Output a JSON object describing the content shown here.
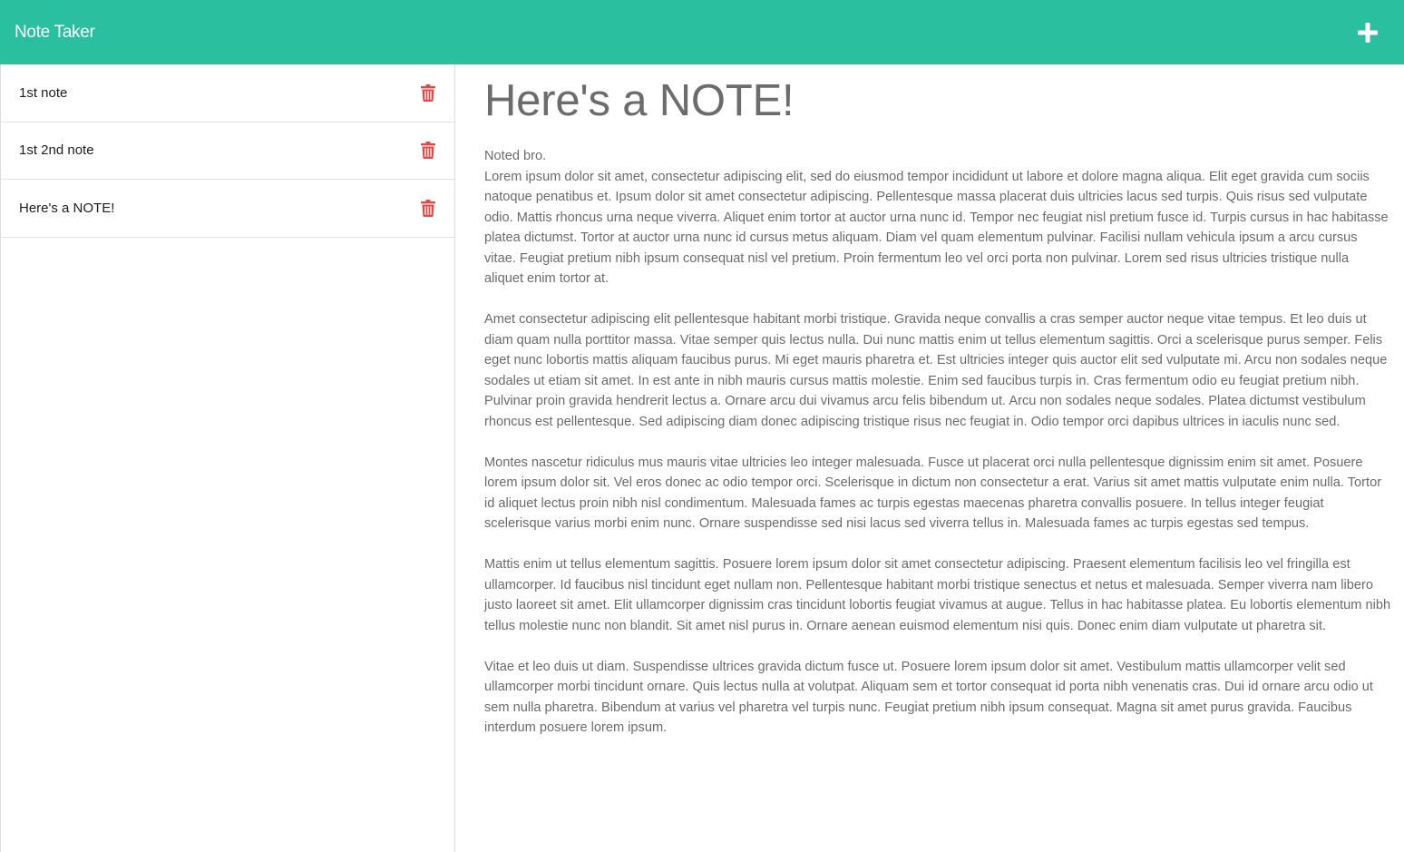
{
  "app": {
    "title": "Note Taker",
    "accent_color": "#2abf9e",
    "delete_color": "#dc4a4a"
  },
  "toolbar": {
    "add_icon": "plus-icon"
  },
  "sidebar": {
    "notes": [
      {
        "title": "1st note"
      },
      {
        "title": "1st 2nd note"
      },
      {
        "title": "Here's a NOTE!"
      }
    ],
    "delete_icon": "trash-icon"
  },
  "active_note": {
    "title": "Here's a NOTE!",
    "text": "Noted bro.\nLorem ipsum dolor sit amet, consectetur adipiscing elit, sed do eiusmod tempor incididunt ut labore et dolore magna aliqua. Elit eget gravida cum sociis natoque penatibus et. Ipsum dolor sit amet consectetur adipiscing. Pellentesque massa placerat duis ultricies lacus sed turpis. Quis risus sed vulputate odio. Mattis rhoncus urna neque viverra. Aliquet enim tortor at auctor urna nunc id. Tempor nec feugiat nisl pretium fusce id. Turpis cursus in hac habitasse platea dictumst. Tortor at auctor urna nunc id cursus metus aliquam. Diam vel quam elementum pulvinar. Facilisi nullam vehicula ipsum a arcu cursus vitae. Feugiat pretium nibh ipsum consequat nisl vel pretium. Proin fermentum leo vel orci porta non pulvinar. Lorem sed risus ultricies tristique nulla aliquet enim tortor at.\n\nAmet consectetur adipiscing elit pellentesque habitant morbi tristique. Gravida neque convallis a cras semper auctor neque vitae tempus. Et leo duis ut diam quam nulla porttitor massa. Vitae semper quis lectus nulla. Dui nunc mattis enim ut tellus elementum sagittis. Orci a scelerisque purus semper. Felis eget nunc lobortis mattis aliquam faucibus purus. Mi eget mauris pharetra et. Est ultricies integer quis auctor elit sed vulputate mi. Arcu non sodales neque sodales ut etiam sit amet. In est ante in nibh mauris cursus mattis molestie. Enim sed faucibus turpis in. Cras fermentum odio eu feugiat pretium nibh. Pulvinar proin gravida hendrerit lectus a. Ornare arcu dui vivamus arcu felis bibendum ut. Arcu non sodales neque sodales. Platea dictumst vestibulum rhoncus est pellentesque. Sed adipiscing diam donec adipiscing tristique risus nec feugiat in. Odio tempor orci dapibus ultrices in iaculis nunc sed.\n\nMontes nascetur ridiculus mus mauris vitae ultricies leo integer malesuada. Fusce ut placerat orci nulla pellentesque dignissim enim sit amet. Posuere lorem ipsum dolor sit. Vel eros donec ac odio tempor orci. Scelerisque in dictum non consectetur a erat. Varius sit amet mattis vulputate enim nulla. Tortor id aliquet lectus proin nibh nisl condimentum. Malesuada fames ac turpis egestas maecenas pharetra convallis posuere. In tellus integer feugiat scelerisque varius morbi enim nunc. Ornare suspendisse sed nisi lacus sed viverra tellus in. Malesuada fames ac turpis egestas sed tempus.\n\nMattis enim ut tellus elementum sagittis. Posuere lorem ipsum dolor sit amet consectetur adipiscing. Praesent elementum facilisis leo vel fringilla est ullamcorper. Id faucibus nisl tincidunt eget nullam non. Pellentesque habitant morbi tristique senectus et netus et malesuada. Semper viverra nam libero justo laoreet sit amet. Elit ullamcorper dignissim cras tincidunt lobortis feugiat vivamus at augue. Tellus in hac habitasse platea. Eu lobortis elementum nibh tellus molestie nunc non blandit. Sit amet nisl purus in. Ornare aenean euismod elementum nisi quis. Donec enim diam vulputate ut pharetra sit.\n\nVitae et leo duis ut diam. Suspendisse ultrices gravida dictum fusce ut. Posuere lorem ipsum dolor sit amet. Vestibulum mattis ullamcorper velit sed ullamcorper morbi tincidunt ornare. Quis lectus nulla at volutpat. Aliquam sem et tortor consequat id porta nibh venenatis cras. Dui id ornare arcu odio ut sem nulla pharetra. Bibendum at varius vel pharetra vel turpis nunc. Feugiat pretium nibh ipsum consequat. Magna sit amet purus gravida. Faucibus interdum posuere lorem ipsum."
  }
}
